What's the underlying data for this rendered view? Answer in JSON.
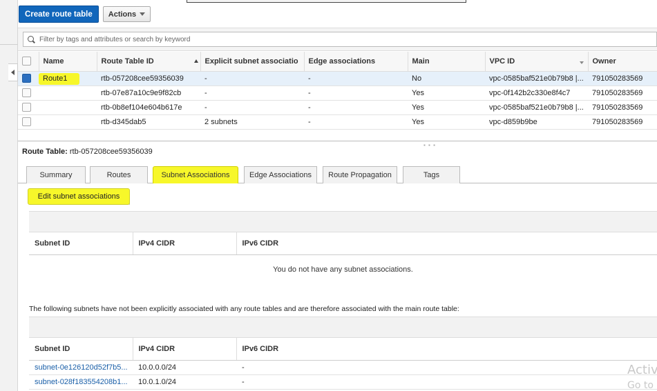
{
  "toolbar": {
    "create_label": "Create route table",
    "actions_label": "Actions"
  },
  "filter": {
    "placeholder": "Filter by tags and attributes or search by keyword"
  },
  "route_tables": {
    "columns": [
      "Name",
      "Route Table ID",
      "Explicit subnet associatio",
      "Edge associations",
      "Main",
      "VPC ID",
      "Owner"
    ],
    "rows": [
      {
        "name": "Route1",
        "id": "rtb-057208cee59356039",
        "explicit": "-",
        "edge": "-",
        "main": "No",
        "vpc": "vpc-0585baf521e0b79b8 |...",
        "owner": "791050283569",
        "selected": true
      },
      {
        "name": "",
        "id": "rtb-07e87a10c9e9f82cb",
        "explicit": "-",
        "edge": "-",
        "main": "Yes",
        "vpc": "vpc-0f142b2c330e8f4c7",
        "owner": "791050283569",
        "selected": false
      },
      {
        "name": "",
        "id": "rtb-0b8ef104e604b617e",
        "explicit": "-",
        "edge": "-",
        "main": "Yes",
        "vpc": "vpc-0585baf521e0b79b8 |...",
        "owner": "791050283569",
        "selected": false
      },
      {
        "name": "",
        "id": "rtb-d345dab5",
        "explicit": "2 subnets",
        "edge": "-",
        "main": "Yes",
        "vpc": "vpc-d859b9be",
        "owner": "791050283569",
        "selected": false
      }
    ]
  },
  "detail": {
    "title_label": "Route Table:",
    "title_value": "rtb-057208cee59356039",
    "tabs": [
      "Summary",
      "Routes",
      "Subnet Associations",
      "Edge Associations",
      "Route Propagation",
      "Tags"
    ],
    "active_tab": "Subnet Associations",
    "edit_label": "Edit subnet associations",
    "assoc_columns": [
      "Subnet ID",
      "IPv4 CIDR",
      "IPv6 CIDR"
    ],
    "empty_message": "You do not have any subnet associations.",
    "note": "The following subnets have not been explicitly associated with any route tables and are therefore associated with the main route table:",
    "unassoc_columns": [
      "Subnet ID",
      "IPv4 CIDR",
      "IPv6 CIDR"
    ],
    "unassoc_rows": [
      {
        "subnet": "subnet-0e126120d52f7b5...",
        "ipv4": "10.0.0.0/24",
        "ipv6": "-"
      },
      {
        "subnet": "subnet-028f183554208b1...",
        "ipv4": "10.0.1.0/24",
        "ipv6": "-"
      }
    ]
  },
  "watermark": {
    "line1": "Activ",
    "line2": "Go to"
  },
  "colors": {
    "primary": "#1166bb",
    "highlight": "#f7f72a",
    "link": "#1a5fa8"
  }
}
